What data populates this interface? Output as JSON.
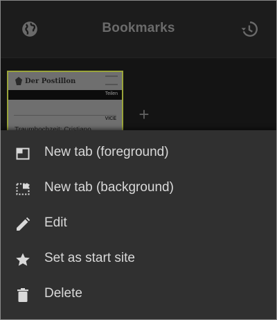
{
  "toolbar": {
    "title": "Bookmarks",
    "left_icon": "globe-icon",
    "right_icon": "history-icon"
  },
  "bookmark_tile": {
    "site_name": "Der Postillon",
    "share_label": "Teilen",
    "source_label": "VICE",
    "headline": "Traumhochzeit: Cristiano",
    "accent_color": "#9aa43a"
  },
  "add_button": {
    "label": "+"
  },
  "context_menu": {
    "items": [
      {
        "label": "New tab (foreground)",
        "icon": "new-tab-foreground-icon"
      },
      {
        "label": "New tab (background)",
        "icon": "new-tab-background-icon"
      },
      {
        "label": "Edit",
        "icon": "pencil-icon"
      },
      {
        "label": "Set as start site",
        "icon": "star-icon"
      },
      {
        "label": "Delete",
        "icon": "trash-icon"
      }
    ]
  },
  "colors": {
    "sheet_background": "#303030",
    "menu_text": "#d9d9d9",
    "toolbar_text": "#6b6b6b"
  }
}
